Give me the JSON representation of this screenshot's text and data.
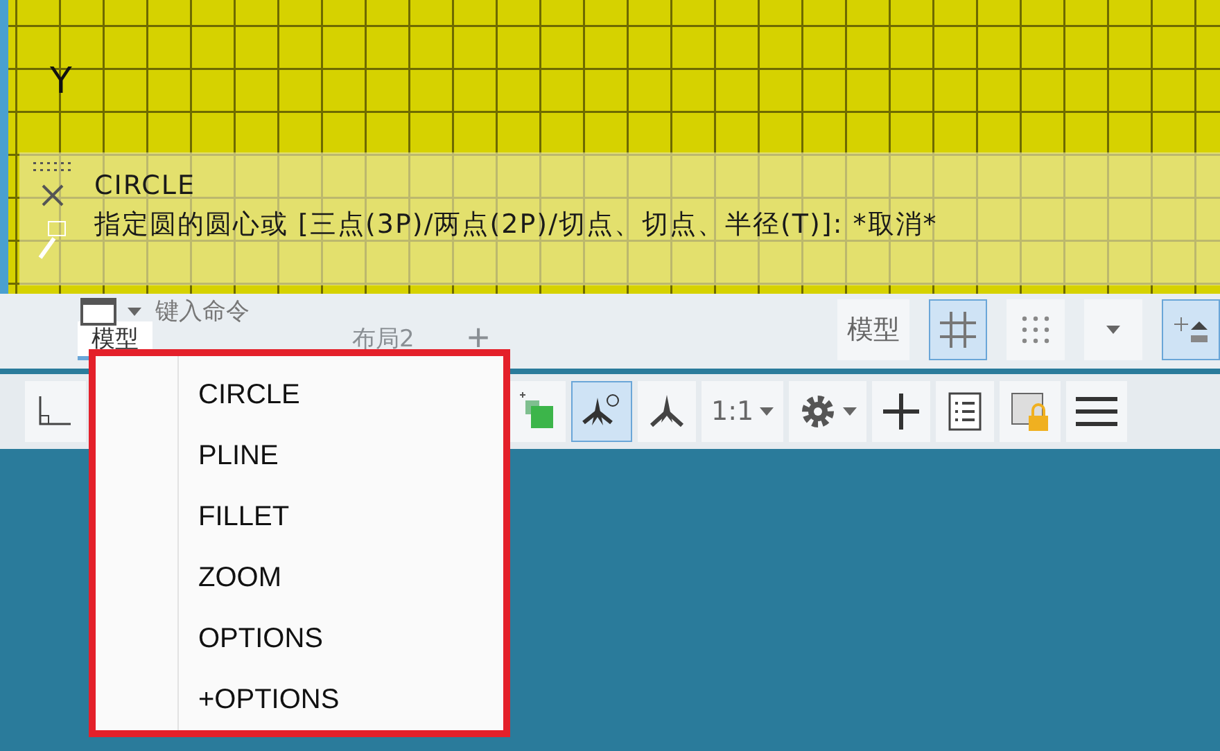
{
  "canvas": {
    "axis_label": "Y"
  },
  "command_history": [
    "CIRCLE",
    "指定圆的圆心或 [三点(3P)/两点(2P)/切点、切点、半径(T)]: *取消*"
  ],
  "command_input": {
    "placeholder": "键入命令"
  },
  "layout_tabs": [
    {
      "label": "模型",
      "selected": true
    },
    {
      "label": "布局2",
      "selected": false
    }
  ],
  "add_tab": "+",
  "status_bar": {
    "model_button": "模型",
    "toggles": [
      {
        "kind": "grid",
        "on": true
      },
      {
        "kind": "snap",
        "on": false
      }
    ],
    "tools": [
      {
        "kind": "ucs",
        "on": false
      },
      {
        "kind": "object",
        "on": false
      },
      {
        "kind": "isodraft",
        "on": true
      },
      {
        "kind": "annotate",
        "on": false
      }
    ],
    "scale": "1:1"
  },
  "recent_commands": [
    "CIRCLE",
    "PLINE",
    "FILLET",
    "ZOOM",
    "OPTIONS",
    "+OPTIONS"
  ]
}
